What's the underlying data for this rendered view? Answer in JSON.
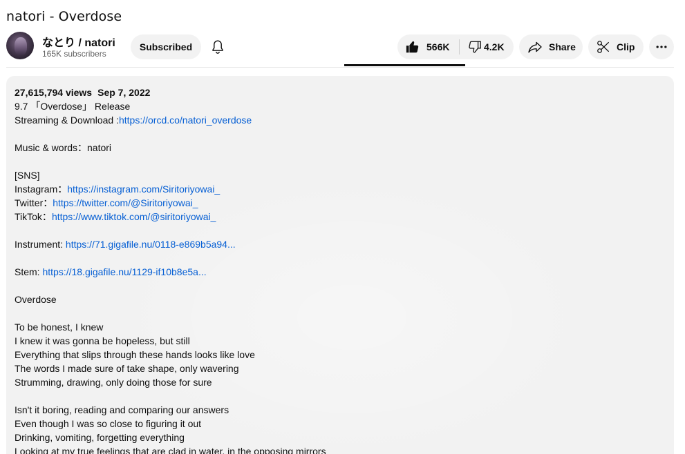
{
  "video": {
    "title": "natori - Overdose"
  },
  "channel": {
    "name": "なとり / natori",
    "subscribers": "165K subscribers",
    "subscribe_label": "Subscribed"
  },
  "actions": {
    "likes": "566K",
    "dislikes": "4.2K",
    "share_label": "Share",
    "clip_label": "Clip"
  },
  "description": {
    "views": "27,615,794 views",
    "date": "Sep 7, 2022",
    "lines": [
      {
        "text": "9.7 「Overdose」 Release",
        "link": ""
      },
      {
        "text": "Streaming & Download :",
        "link": "https://orcd.co/natori_overdose"
      },
      {
        "text": "",
        "link": ""
      },
      {
        "text": "Music & words：natori",
        "link": ""
      },
      {
        "text": "",
        "link": ""
      },
      {
        "text": "[SNS]",
        "link": ""
      },
      {
        "text": "Instagram：",
        "link": "https://instagram.com/Siritoriyowai_"
      },
      {
        "text": "Twitter：",
        "link": "https://twitter.com/@Siritoriyowai_"
      },
      {
        "text": "TikTok：",
        "link": "https://www.tiktok.com/@siritoriyowai_"
      },
      {
        "text": "",
        "link": ""
      },
      {
        "text": "Instrument: ",
        "link": "https://71.gigafile.nu/0118-e869b5a94..."
      },
      {
        "text": "",
        "link": ""
      },
      {
        "text": "Stem: ",
        "link": "https://18.gigafile.nu/1129-if10b8e5a..."
      },
      {
        "text": "",
        "link": ""
      },
      {
        "text": "Overdose",
        "link": ""
      },
      {
        "text": "",
        "link": ""
      },
      {
        "text": "To be honest, I knew",
        "link": ""
      },
      {
        "text": "I knew it was gonna be hopeless, but still",
        "link": ""
      },
      {
        "text": "Everything that slips through these hands looks like love",
        "link": ""
      },
      {
        "text": "The words I made sure of take shape, only wavering",
        "link": ""
      },
      {
        "text": "Strumming, drawing, only doing those for sure",
        "link": ""
      },
      {
        "text": "",
        "link": ""
      },
      {
        "text": "Isn't it boring, reading and comparing our answers",
        "link": ""
      },
      {
        "text": "Even though I was so close to figuring it out",
        "link": ""
      },
      {
        "text": "Drinking, vomiting, forgetting everything",
        "link": ""
      },
      {
        "text": "Looking at my true feelings that are clad in water, in the opposing mirrors",
        "link": ""
      }
    ]
  },
  "colors": {
    "link": "#065fd4",
    "pill_bg": "#f2f2f2",
    "desc_bg": "#f2f2f2"
  },
  "icons": [
    "bell-icon",
    "thumbs-up-icon",
    "thumbs-down-icon",
    "share-icon",
    "scissors-icon",
    "more-icon"
  ]
}
